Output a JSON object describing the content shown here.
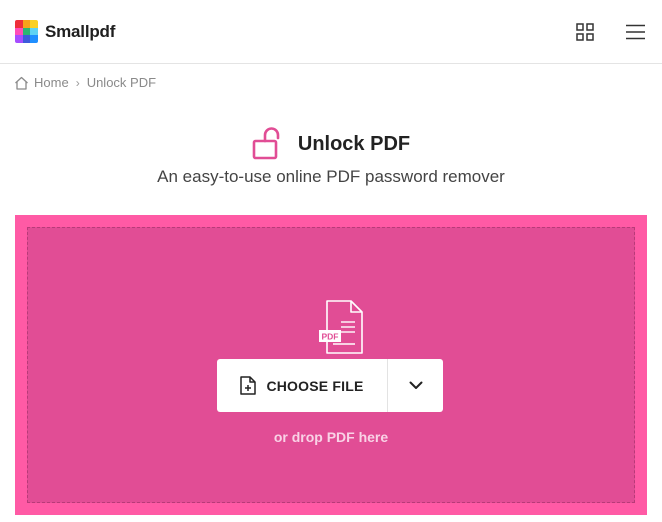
{
  "header": {
    "brand_name": "Smallpdf",
    "apps_icon": "grid-icon",
    "menu_icon": "hamburger-icon",
    "logo_colors": [
      "#ee2e3a",
      "#f7a21b",
      "#fbd023",
      "#2bb673",
      "#1f8fff",
      "#3d5bdb",
      "#a64dff",
      "#ff4db8",
      "#5fd3f3"
    ]
  },
  "breadcrumb": {
    "home_icon": "home-icon",
    "home_label": "Home",
    "separator": "›",
    "current_label": "Unlock PDF"
  },
  "tool": {
    "icon": "unlock-icon",
    "title": "Unlock PDF",
    "subtitle": "An easy-to-use online PDF password remover",
    "accent_color": "#e14d95"
  },
  "dropzone": {
    "outer_color": "#ff5aa5",
    "inner_color": "#e14d95",
    "file_icon": "pdf-file-icon",
    "file_icon_label": "PDF",
    "choose_file_label": "CHOOSE FILE",
    "choose_file_icon": "add-file-icon",
    "dropdown_icon": "chevron-down-icon",
    "drop_hint": "or drop PDF here"
  }
}
